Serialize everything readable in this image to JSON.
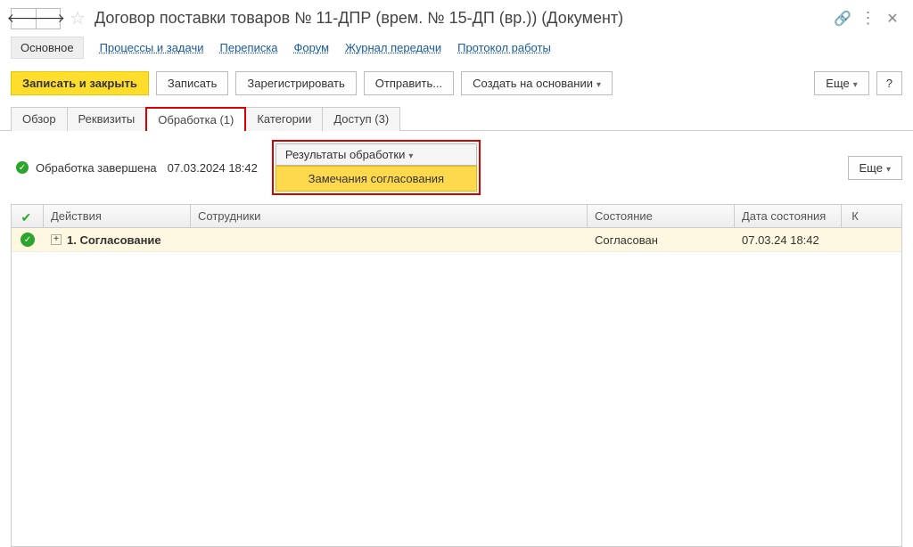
{
  "header": {
    "title": "Договор поставки товаров  № 11-ДПР (врем. № 15-ДП (вр.)) (Документ)"
  },
  "navlinks": {
    "main": "Основное",
    "processes": "Процессы и задачи",
    "correspondence": "Переписка",
    "forum": "Форум",
    "transfer_log": "Журнал передачи",
    "work_protocol": "Протокол работы"
  },
  "toolbar": {
    "save_close": "Записать и закрыть",
    "save": "Записать",
    "register": "Зарегистрировать",
    "send": "Отправить...",
    "create_based": "Создать на основании",
    "more": "Еще",
    "help": "?"
  },
  "tabs": {
    "overview": "Обзор",
    "requisites": "Реквизиты",
    "processing": "Обработка (1)",
    "categories": "Категории",
    "access": "Доступ (3)"
  },
  "status": {
    "text": "Обработка завершена",
    "date": "07.03.2024 18:42",
    "dropdown_label": "Результаты обработки",
    "dropdown_item": "Замечания согласования",
    "more": "Еще"
  },
  "table": {
    "headers": {
      "actions": "Действия",
      "employees": "Сотрудники",
      "state": "Состояние",
      "state_date": "Дата состояния",
      "k": "К"
    },
    "rows": [
      {
        "action": "1. Согласование",
        "employee": "",
        "state": "Согласован",
        "state_date": "07.03.24 18:42"
      }
    ]
  }
}
